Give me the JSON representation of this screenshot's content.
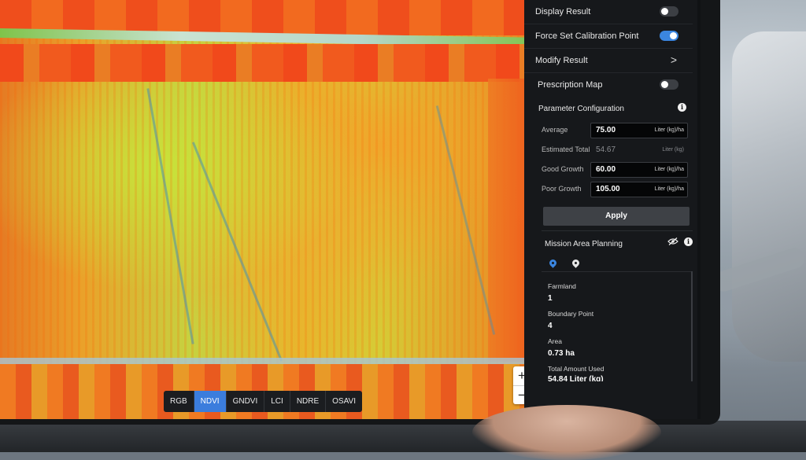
{
  "panel": {
    "display_result": {
      "label": "Display Result",
      "on": false
    },
    "force_calibration": {
      "label": "Force Set Calibration Point",
      "on": true
    },
    "modify_result": {
      "label": "Modify Result",
      "chevron": ">"
    },
    "prescription_map": {
      "label": "Prescription Map",
      "on": false
    },
    "parameter_configuration": {
      "title": "Parameter Configuration",
      "info": "i",
      "fields": [
        {
          "label": "Average",
          "value": "75.00",
          "unit": "Liter (kg)/ha"
        },
        {
          "label": "Estimated Total",
          "value": "54.67",
          "unit": "Liter (kg)"
        },
        {
          "label": "Good Growth",
          "value": "60.00",
          "unit": "Liter (kg)/ha"
        },
        {
          "label": "Poor Growth",
          "value": "105.00",
          "unit": "Liter (kg)/ha"
        }
      ],
      "apply_label": "Apply"
    },
    "mission_area": {
      "title": "Mission Area Planning",
      "info": "i",
      "stats": [
        {
          "label": "Farmland",
          "value": "1"
        },
        {
          "label": "Boundary Point",
          "value": "4"
        },
        {
          "label": "Area",
          "value": "0.73 ha"
        },
        {
          "label": "Total Amount Used",
          "value": "54.84 Liter (kg)"
        }
      ]
    }
  },
  "index_bar": {
    "items": [
      "RGB",
      "NDVI",
      "GNDVI",
      "LCI",
      "NDRE",
      "OSAVI"
    ],
    "active": "NDVI"
  },
  "zoom": {
    "in": "+",
    "out": "−"
  },
  "colors": {
    "accent": "#3b86e0",
    "panel_bg": "#16181b"
  }
}
